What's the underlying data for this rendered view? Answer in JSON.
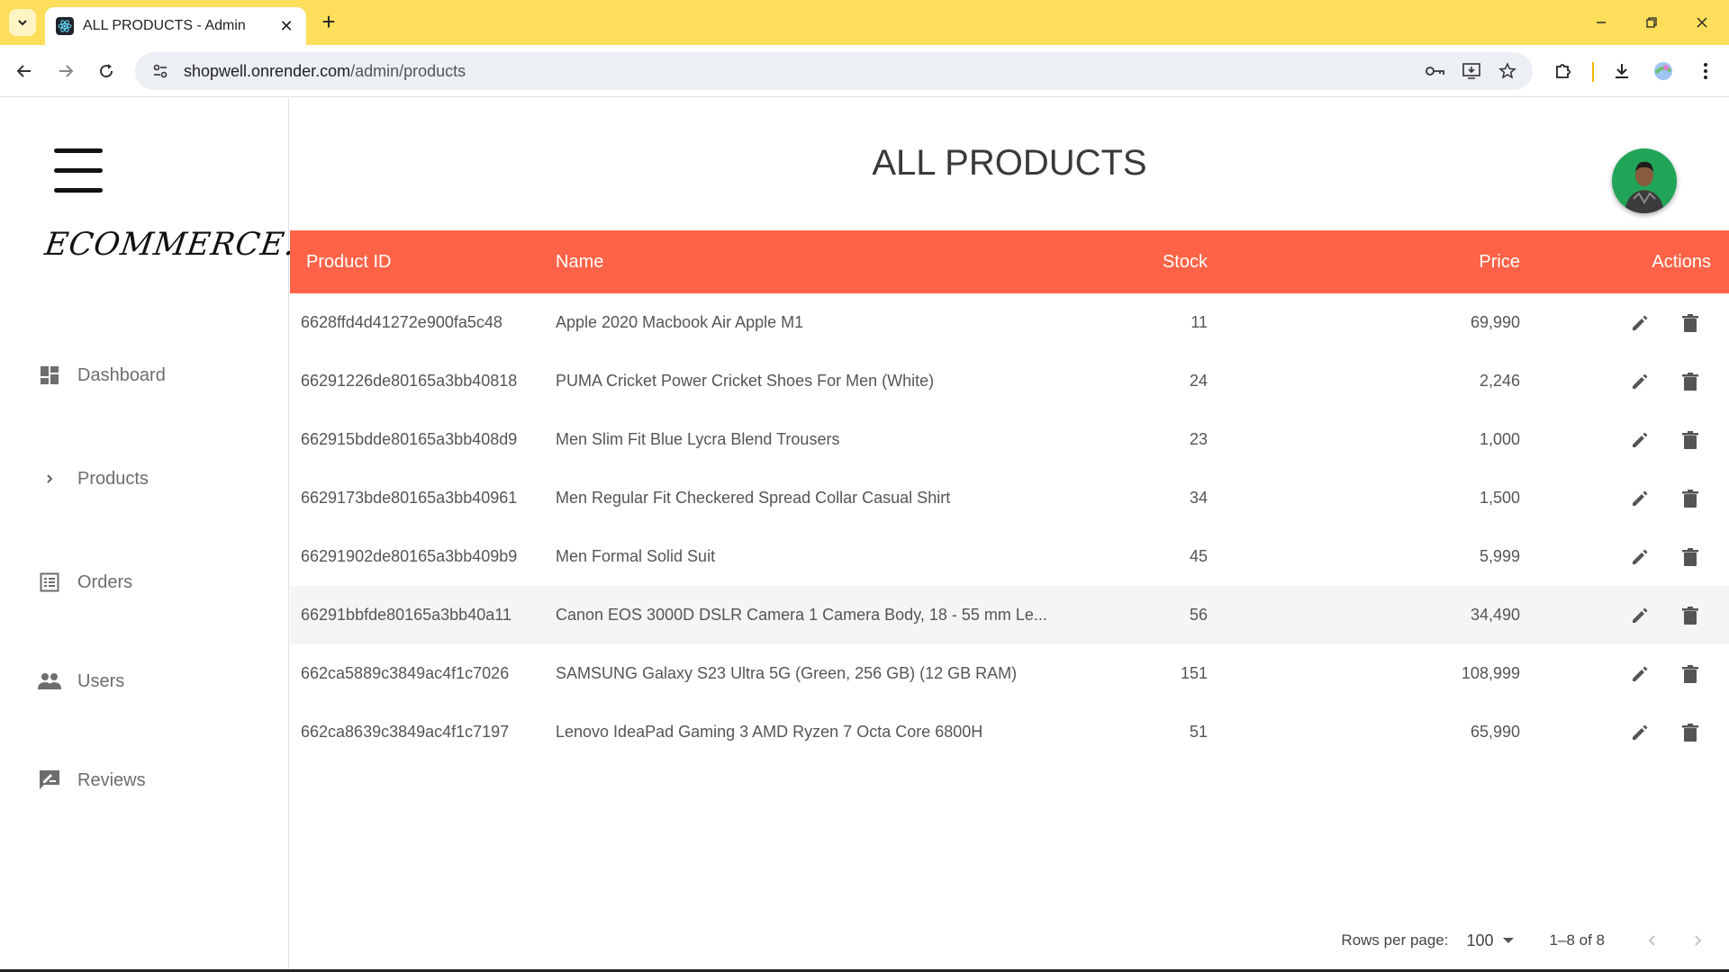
{
  "browser": {
    "tab_title": "ALL PRODUCTS - Admin",
    "new_tab": "+",
    "url_host": "shopwell.onrender.com",
    "url_path": "/admin/products"
  },
  "sidebar": {
    "logo": "ECOMMERCE.",
    "items": [
      {
        "label": "Dashboard",
        "icon": "dashboard-icon"
      },
      {
        "label": "Products",
        "icon": "chevron-right-icon"
      },
      {
        "label": "Orders",
        "icon": "list-alt-icon"
      },
      {
        "label": "Users",
        "icon": "people-icon"
      },
      {
        "label": "Reviews",
        "icon": "rate-review-icon"
      }
    ]
  },
  "main": {
    "heading": "ALL PRODUCTS",
    "columns": {
      "id": "Product ID",
      "name": "Name",
      "stock": "Stock",
      "price": "Price",
      "actions": "Actions"
    },
    "rows": [
      {
        "id": "6628ffd4d41272e900fa5c48",
        "name": "Apple 2020 Macbook Air Apple M1",
        "stock": "11",
        "price": "69,990"
      },
      {
        "id": "66291226de80165a3bb40818",
        "name": "PUMA Cricket Power Cricket Shoes For Men (White)",
        "stock": "24",
        "price": "2,246"
      },
      {
        "id": "662915bdde80165a3bb408d9",
        "name": "Men Slim Fit Blue Lycra Blend Trousers",
        "stock": "23",
        "price": "1,000"
      },
      {
        "id": "6629173bde80165a3bb40961",
        "name": "Men Regular Fit Checkered Spread Collar Casual Shirt",
        "stock": "34",
        "price": "1,500"
      },
      {
        "id": "66291902de80165a3bb409b9",
        "name": "Men Formal Solid Suit",
        "stock": "45",
        "price": "5,999"
      },
      {
        "id": "66291bbfde80165a3bb40a11",
        "name": "Canon EOS 3000D DSLR Camera 1 Camera Body, 18 - 55 mm Le...",
        "stock": "56",
        "price": "34,490"
      },
      {
        "id": "662ca5889c3849ac4f1c7026",
        "name": "SAMSUNG Galaxy S23 Ultra 5G (Green, 256 GB) (12 GB RAM)",
        "stock": "151",
        "price": "108,999"
      },
      {
        "id": "662ca8639c3849ac4f1c7197",
        "name": "Lenovo IdeaPad Gaming 3 AMD Ryzen 7 Octa Core 6800H",
        "stock": "51",
        "price": "65,990"
      }
    ],
    "pagination": {
      "rows_per_page_label": "Rows per page:",
      "rows_per_page_value": "100",
      "range": "1–8 of 8"
    }
  },
  "colors": {
    "browser_frame": "#fede5a",
    "table_header": "#ff6347",
    "avatar_bg": "#22a559"
  }
}
